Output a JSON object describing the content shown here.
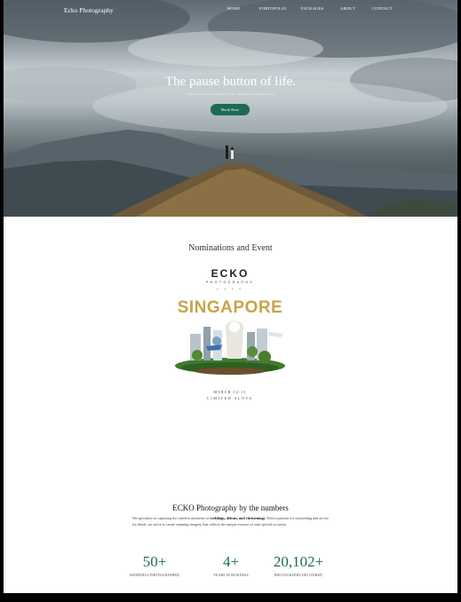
{
  "header": {
    "brand": "Ecko Photography",
    "nav": [
      "HOME",
      "PORTOFOLIO",
      "PACKAGES",
      "ABOUT",
      "CONTACT"
    ]
  },
  "hero": {
    "title": "The pause button of life.",
    "subtitle": "Experience the moments of life, capture through our lens.",
    "button_label": "Book Now"
  },
  "nominations": {
    "title": "Nominations and Event",
    "poster": {
      "brand": "ECKO",
      "sub": "PHOTOGRAPHY",
      "dots": "• • • •",
      "city": "SINGAPORE",
      "date": "MARCH 12-15",
      "slots": "LIMITED SLOTS"
    }
  },
  "numbers": {
    "title": "ECKO Photography by the numbers",
    "desc_1": "We specialize in capturing the timeless moments of ",
    "desc_bold": "weddings, debuts, and christenings",
    "desc_2": ". With a passion for storytelling and an eye for detail, we strive to create stunning imagery that reflects the unique essence of each special occasion.",
    "stats": [
      {
        "value": "50+",
        "label": "WEDDINGS PHOTOGRAPHED"
      },
      {
        "value": "4+",
        "label": "YEARS IN BUSINESS"
      },
      {
        "value": "20,102+",
        "label": "PHOTOGRAPHS DELIVERED"
      }
    ]
  },
  "colors": {
    "accent": "#1e6a55",
    "poster_gold": "#c9a34a"
  }
}
